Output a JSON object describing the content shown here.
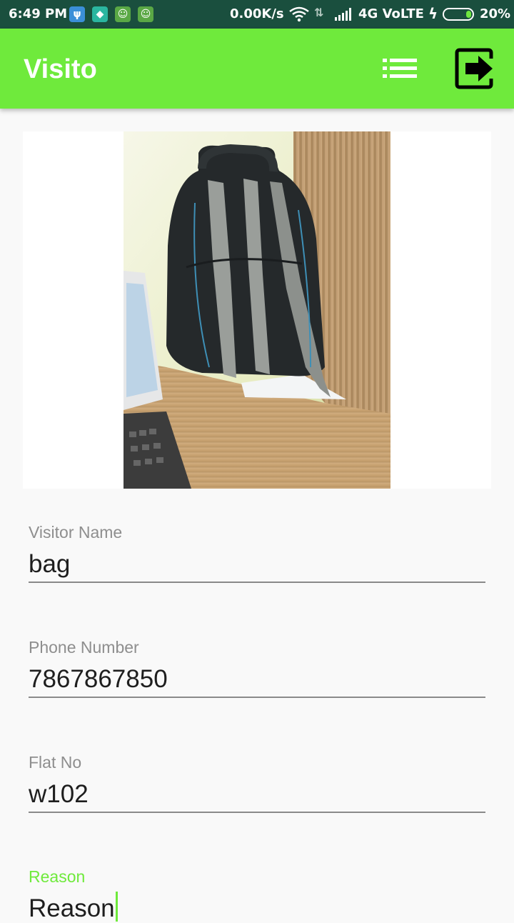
{
  "status_bar": {
    "time": "6:49 PM",
    "net_speed": "0.00K/s",
    "network": "4G VoLTE",
    "battery": "20%",
    "battery_level": 0.2,
    "icons": [
      "usb-icon",
      "shield-icon",
      "android-icon",
      "android-icon",
      "wifi-icon",
      "data-arrows-icon",
      "signal-icon",
      "charging-bolt-icon",
      "battery-icon"
    ]
  },
  "app_bar": {
    "title": "Visito",
    "actions": [
      "list-icon",
      "logout-icon"
    ]
  },
  "photo": {
    "subject": "backpack-photo"
  },
  "form": {
    "visitor_name": {
      "label": "Visitor Name",
      "value": "bag"
    },
    "phone_number": {
      "label": "Phone Number",
      "value": "7867867850"
    },
    "flat_no": {
      "label": "Flat No",
      "value": "w102"
    },
    "reason": {
      "label": "Reason",
      "value": "Reason"
    }
  },
  "colors": {
    "accent": "#6fea3c",
    "status_bar": "#1a4f3e",
    "background": "#f9f9f9"
  }
}
